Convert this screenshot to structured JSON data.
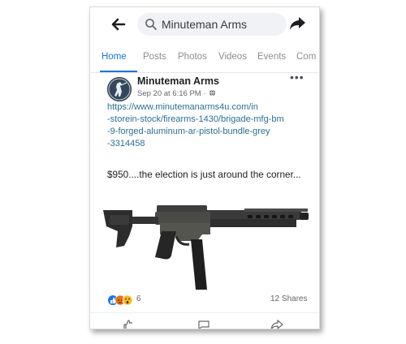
{
  "topbar": {
    "search_text": "Minuteman Arms"
  },
  "tabs": [
    {
      "label": "Home",
      "active": true
    },
    {
      "label": "Posts",
      "active": false
    },
    {
      "label": "Photos",
      "active": false
    },
    {
      "label": "Videos",
      "active": false
    },
    {
      "label": "Events",
      "active": false
    },
    {
      "label": "Com",
      "active": false
    }
  ],
  "post": {
    "author": "Minuteman Arms",
    "timestamp": "Sep 20 at 6:16 PM",
    "meta_separator": " · ",
    "more_glyph": "•••",
    "link_lines": [
      "https://www.minutemanarms4u.com/in",
      "-storein-stock/firearms-1430/brigade-mfg-bm",
      "-9-forged-aluminum-ar-pistol-bundle-grey",
      "-3314458"
    ],
    "text": "$950....the election is just around the corner..."
  },
  "engagement": {
    "reaction_count": "6",
    "shares": "12 Shares"
  },
  "colors": {
    "accent": "#1b74e4",
    "link": "#2d6e95",
    "like": "#1877f2",
    "wow": "#f7b928",
    "love_angry": "#e9710f"
  },
  "icons": [
    "back-arrow-icon",
    "search-icon",
    "share-icon",
    "globe-icon",
    "more-icon",
    "like-reaction-icon",
    "angry-reaction-icon",
    "wow-reaction-icon"
  ]
}
